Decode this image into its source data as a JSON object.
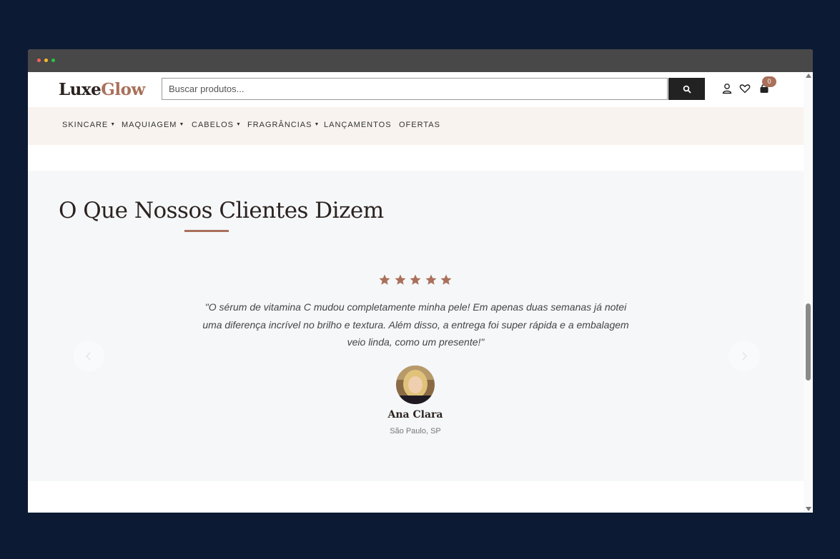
{
  "header": {
    "logo_part1": "Luxe",
    "logo_part2": "Glow",
    "search_placeholder": "Buscar produtos...",
    "cart_count": "0"
  },
  "nav": {
    "items": [
      {
        "label": "SKINCARE",
        "dropdown": true
      },
      {
        "label": "MAQUIAGEM",
        "dropdown": true
      },
      {
        "label": "CABELOS",
        "dropdown": true
      },
      {
        "label": "FRAGRÂNCIAS",
        "dropdown": true
      },
      {
        "label": "LANÇAMENTOS",
        "dropdown": false
      },
      {
        "label": "OFERTAS",
        "dropdown": false
      }
    ]
  },
  "testimonials": {
    "title": "O Que Nossos Clientes Dizem",
    "rating": 5,
    "quote": "\"O sérum de vitamina C mudou completamente minha pele! Em apenas duas semanas já notei uma diferença incrível no brilho e textura. Além disso, a entrega foi super rápida e a embalagem veio linda, como um presente!\"",
    "customer_name": "Ana Clara",
    "customer_location": "São Paulo, SP"
  },
  "colors": {
    "accent": "#a9705a",
    "dark": "#2b2320",
    "nav_bg": "#f8f3ee",
    "section_bg": "#f6f7f9",
    "page_bg": "#0c1a33"
  }
}
